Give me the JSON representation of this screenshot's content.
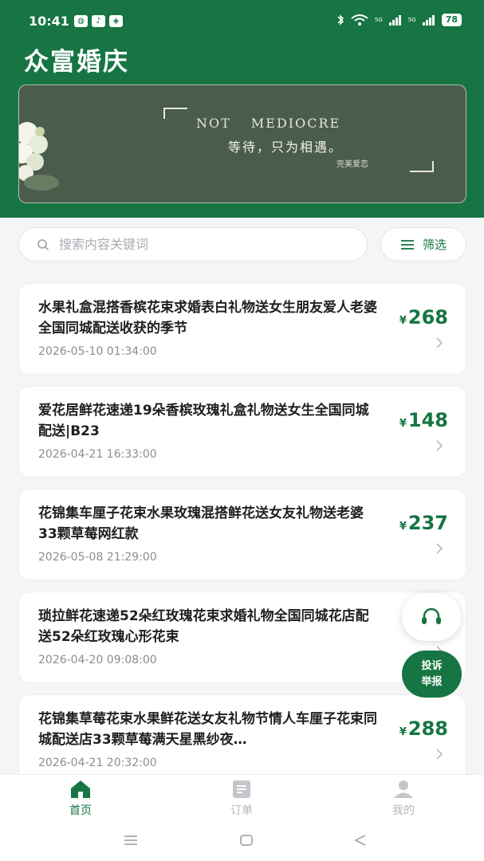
{
  "status_bar": {
    "time": "10:41",
    "battery": "78",
    "network_1": "5G",
    "network_2": "5G"
  },
  "header": {
    "title": "众富婚庆",
    "background_color": "#167543"
  },
  "banner": {
    "headline": "NOT MEDIOCRE",
    "subtitle": "等待，只为相遇。",
    "tag": "完美爱恋"
  },
  "search": {
    "placeholder": "搜索内容关键词",
    "value": ""
  },
  "filter": {
    "label": "筛选"
  },
  "products": [
    {
      "title": "水果礼盒混搭香槟花束求婚表白礼物送女生朋友爱人老婆全国同城配送收获的季节",
      "date": "2026-05-10 01:34:00",
      "currency": "¥",
      "price": "268"
    },
    {
      "title": "爱花居鲜花速递19朵香槟玫瑰礼盒礼物送女生全国同城配送|B23",
      "date": "2026-04-21 16:33:00",
      "currency": "¥",
      "price": "148"
    },
    {
      "title": "花锦集车厘子花束水果玫瑰混搭鲜花送女友礼物送老婆33颗草莓网红款",
      "date": "2026-05-08 21:29:00",
      "currency": "¥",
      "price": "237"
    },
    {
      "title": "琐拉鲜花速递52朵红玫瑰花束求婚礼物全国同城花店配送52朵红玫瑰心形花束",
      "date": "2026-04-20 09:08:00",
      "currency": "¥",
      "price": ""
    },
    {
      "title": "花锦集草莓花束水果鲜花送女友礼物节情人车厘子花束同城配送店33颗草莓满天星黑纱夜…",
      "date": "2026-04-21 20:32:00",
      "currency": "¥",
      "price": "288"
    }
  ],
  "floating": {
    "report_line1": "投诉",
    "report_line2": "举报"
  },
  "tabbar": {
    "home": "首页",
    "orders": "订单",
    "profile": "我的"
  },
  "colors": {
    "accent": "#167543",
    "background": "#f4f5f7",
    "muted_text": "#8a8d92"
  }
}
